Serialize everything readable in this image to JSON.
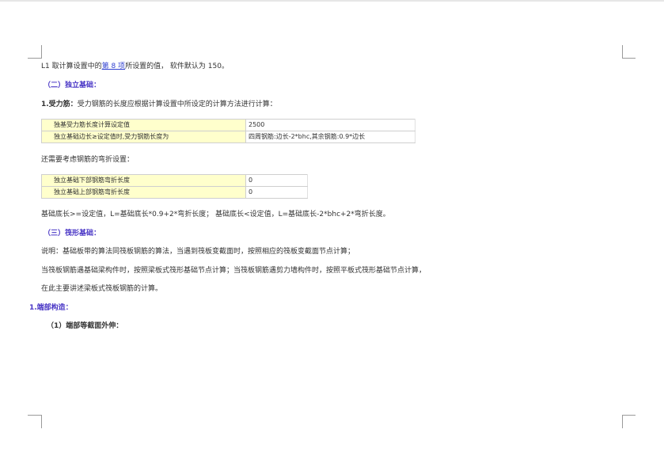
{
  "line1": {
    "prefix": "L1 取计算设置中的",
    "link": "第 8 项",
    "suffix": "所设置的值，  软件默认为 150。"
  },
  "sec2_heading": "（二）独立基础：",
  "rebar_label": "1.受力筋：",
  "rebar_text": "受力钢筋的长度应根据计算设置中所设定的计算方法进行计算：",
  "table1": [
    {
      "name": "独基受力筋长度计算设定值",
      "value": "2500"
    },
    {
      "name": "独立基础边长≥设定值时,受力钢筋长度为",
      "value": "四周钢筋:边长-2*bhc,其余钢筋:0.9*边长"
    }
  ],
  "bend_intro": "还需要考虑钢筋的弯折设置：",
  "table2": [
    {
      "name": "独立基础下部钢筋弯折长度",
      "value": "0"
    },
    {
      "name": "独立基础上部钢筋弯折长度",
      "value": "0"
    }
  ],
  "formula": "基础底长>=设定值，L=基础底长*0.9+2*弯折长度； 基础底长<设定值，L=基础底长-2*bhc+2*弯折长度。",
  "sec3_heading": "（三）筏形基础：",
  "para1": "说明：基础板带的算法同筏板钢筋的算法，当遇到筏板变截面时，按照相应的筏板变截面节点计算；",
  "para2": "当筏板钢筋遇基础梁构件时，按照梁板式筏形基础节点计算；当筏板钢筋遇剪力墙构件时，按照平板式筏形基础节点计算，",
  "para3": "在此主要讲述梁板式筏板钢筋的计算。",
  "end_heading": "1.端部构造：",
  "end_sub": "（1）端部等截面外伸："
}
